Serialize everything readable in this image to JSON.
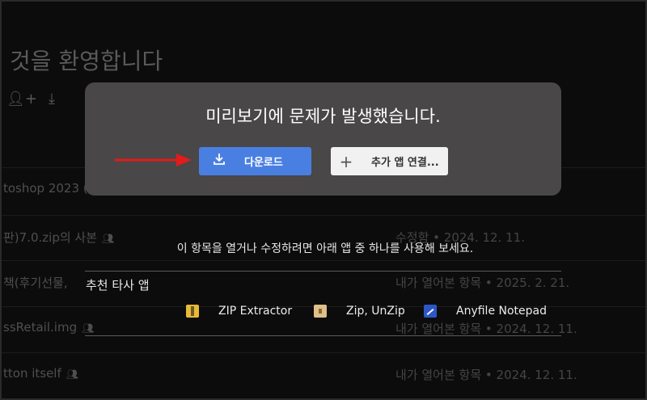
{
  "background": {
    "title": "것을 환영합니다",
    "rows": [
      {
        "name": "toshop 2023 (",
        "meta": "",
        "shared": false
      },
      {
        "name": "판)7.0.zip의 사본",
        "meta": "수정함 • 2024. 12. 11.",
        "shared": true
      },
      {
        "name": "책(후기선물,",
        "meta": "내가 열어본 항목 • 2025. 2. 21.",
        "shared": false
      },
      {
        "name": "ssRetail.img",
        "meta": "내가 열어본 항목 • 2024. 12. 11.",
        "shared": true
      },
      {
        "name": "tton itself",
        "meta": "내가 열어본 항목 • 2024. 12. 11.",
        "shared": true
      }
    ],
    "icons": [
      "add-person-icon",
      "download-icon"
    ]
  },
  "modal": {
    "title": "미리보기에 문제가 발생했습니다.",
    "download_label": "다운로드",
    "connect_label": "추가 앱 연결..."
  },
  "hint": "이 항목을 열거나 수정하려면 아래 앱 중 하나를 사용해 보세요.",
  "recommended": {
    "label": "추천 타사 앱",
    "apps": [
      {
        "name": "ZIP Extractor",
        "icon": "zip-extractor-icon"
      },
      {
        "name": "Zip, UnZip",
        "icon": "zip-unzip-icon"
      },
      {
        "name": "Anyfile Notepad",
        "icon": "anyfile-notepad-icon"
      }
    ]
  },
  "colors": {
    "download_button": "#4a7fe2",
    "modal_bg": "#4a4748",
    "arrow": "#e31b1b"
  }
}
